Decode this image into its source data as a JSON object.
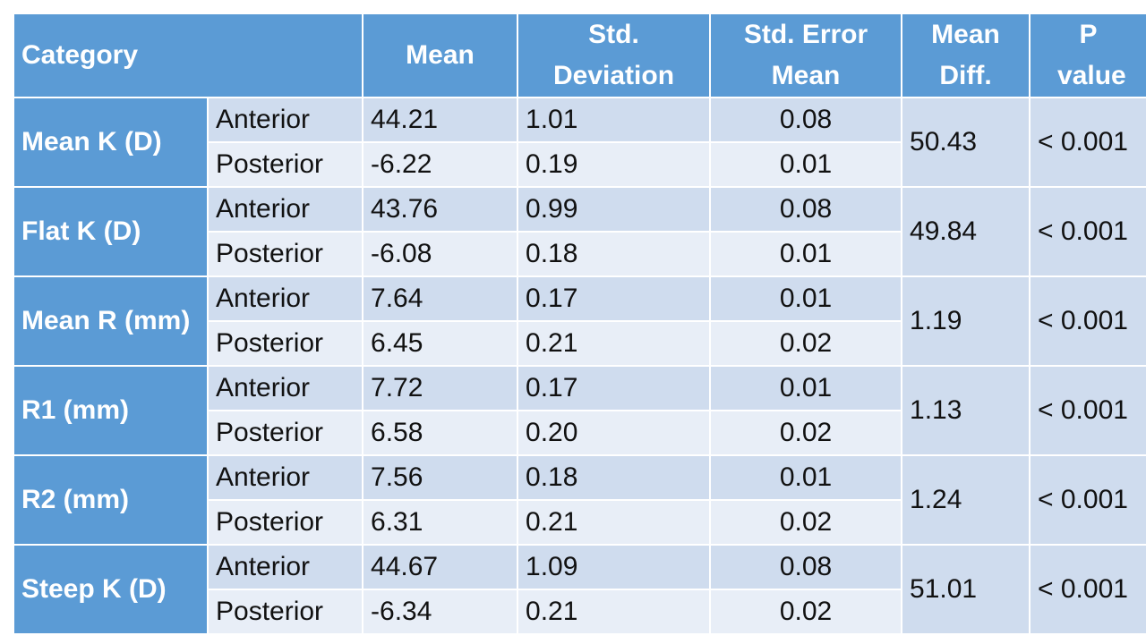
{
  "headers": {
    "category": "Category",
    "mean": "Mean",
    "std_dev": "Std. Deviation",
    "std_err": "Std. Error Mean",
    "mean_diff": "Mean Diff.",
    "p_value": "P value"
  },
  "rows": [
    {
      "category": "Mean K (D)",
      "anterior": {
        "label": "Anterior",
        "mean": "44.21",
        "sd": "1.01",
        "se": "0.08"
      },
      "posterior": {
        "label": "Posterior",
        "mean": "-6.22",
        "sd": "0.19",
        "se": "0.01"
      },
      "mean_diff": "50.43",
      "p": "< 0.001"
    },
    {
      "category": "Flat K (D)",
      "anterior": {
        "label": "Anterior",
        "mean": "43.76",
        "sd": "0.99",
        "se": "0.08"
      },
      "posterior": {
        "label": "Posterior",
        "mean": "-6.08",
        "sd": "0.18",
        "se": "0.01"
      },
      "mean_diff": "49.84",
      "p": "< 0.001"
    },
    {
      "category": "Mean R (mm)",
      "anterior": {
        "label": "Anterior",
        "mean": "7.64",
        "sd": "0.17",
        "se": "0.01"
      },
      "posterior": {
        "label": "Posterior",
        "mean": "6.45",
        "sd": "0.21",
        "se": "0.02"
      },
      "mean_diff": "1.19",
      "p": "< 0.001"
    },
    {
      "category": "R1 (mm)",
      "anterior": {
        "label": "Anterior",
        "mean": "7.72",
        "sd": "0.17",
        "se": "0.01"
      },
      "posterior": {
        "label": "Posterior",
        "mean": "6.58",
        "sd": "0.20",
        "se": "0.02"
      },
      "mean_diff": "1.13",
      "p": "< 0.001"
    },
    {
      "category": "R2 (mm)",
      "anterior": {
        "label": "Anterior",
        "mean": "7.56",
        "sd": "0.18",
        "se": "0.01"
      },
      "posterior": {
        "label": "Posterior",
        "mean": "6.31",
        "sd": "0.21",
        "se": "0.02"
      },
      "mean_diff": "1.24",
      "p": "< 0.001"
    },
    {
      "category": "Steep K (D)",
      "anterior": {
        "label": "Anterior",
        "mean": "44.67",
        "sd": "1.09",
        "se": "0.08"
      },
      "posterior": {
        "label": "Posterior",
        "mean": "-6.34",
        "sd": "0.21",
        "se": "0.02"
      },
      "mean_diff": "51.01",
      "p": "< 0.001"
    }
  ],
  "colors": {
    "header": "#5b9bd5",
    "row_dark": "#cfdcee",
    "row_light": "#e8eef7"
  }
}
